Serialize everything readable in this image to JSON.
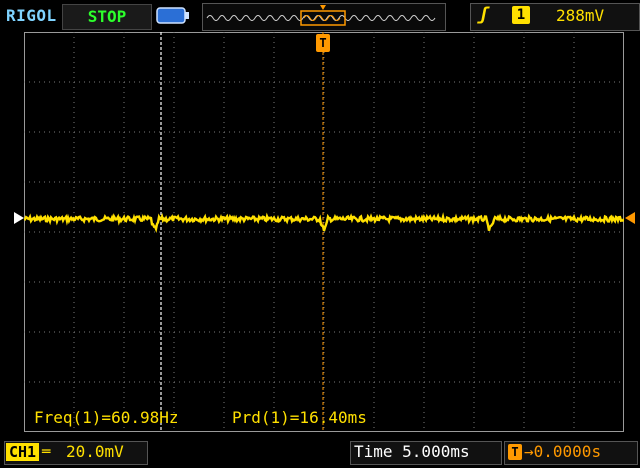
{
  "header": {
    "brand": "RIGOL",
    "run_state": "STOP",
    "trigger_edge_icon": "rising-edge-icon",
    "trigger_source": "1",
    "trigger_level": "288mV"
  },
  "markers": {
    "trigger_position": "T",
    "ch1_ground": "1"
  },
  "measurements": {
    "freq": "Freq(1)=60.98Hz",
    "period": "Prd(1)=16.40ms"
  },
  "footer": {
    "channel_label": "CH1",
    "coupling_icon": "dc-coupling-icon",
    "volts_per_div": "20.0mV",
    "timebase": "Time 5.000ms",
    "trigger_offset": "0.0000s",
    "trigger_offset_icon": "T"
  },
  "colors": {
    "channel1": "#ffe000",
    "trigger": "#ff9900",
    "grid": "#9a9a9a",
    "run_state": "#2cff2c"
  }
}
